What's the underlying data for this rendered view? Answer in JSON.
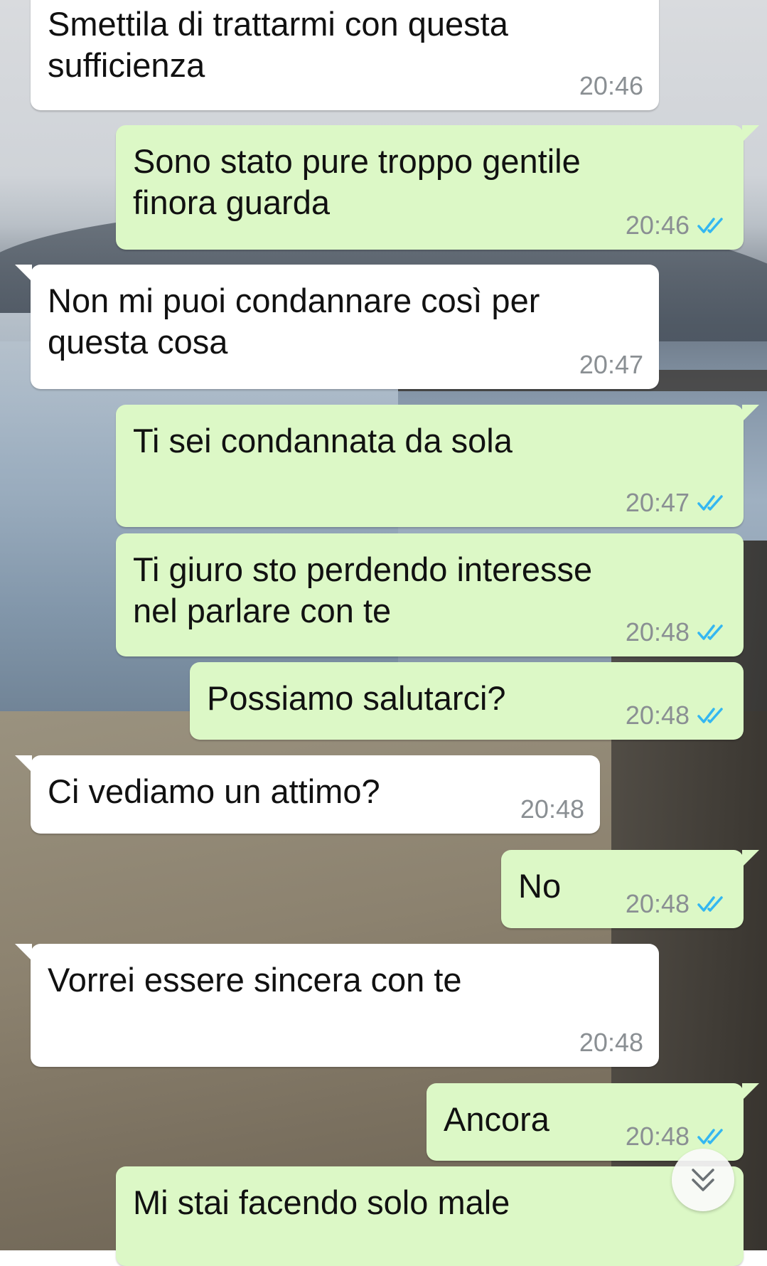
{
  "colors": {
    "incoming_bubble": "#ffffff",
    "outgoing_bubble": "#dcf8c6",
    "read_ticks": "#34b7f1",
    "timestamp": "#8a8f93"
  },
  "messages": [
    {
      "direction": "incoming",
      "text": "Smettila di trattarmi con questa\nsufficienza",
      "time": "20:46"
    },
    {
      "direction": "outgoing",
      "text": "Sono stato pure troppo gentile\nfinora guarda",
      "time": "20:46",
      "status": "read"
    },
    {
      "direction": "incoming",
      "text": "Non mi puoi condannare così per\nquesta cosa",
      "time": "20:47"
    },
    {
      "direction": "outgoing",
      "text": "Ti sei condannata da sola",
      "time": "20:47",
      "status": "read"
    },
    {
      "direction": "outgoing",
      "text": "Ti giuro sto perdendo interesse\nnel parlare con te",
      "time": "20:48",
      "status": "read"
    },
    {
      "direction": "outgoing",
      "text": "Possiamo salutarci?",
      "time": "20:48",
      "status": "read"
    },
    {
      "direction": "incoming",
      "text": "Ci vediamo un attimo?",
      "time": "20:48"
    },
    {
      "direction": "outgoing",
      "text": "No",
      "time": "20:48",
      "status": "read"
    },
    {
      "direction": "incoming",
      "text": "Vorrei essere sincera con te",
      "time": "20:48"
    },
    {
      "direction": "outgoing",
      "text": "Ancora",
      "time": "20:48",
      "status": "read"
    },
    {
      "direction": "outgoing",
      "text": "Mi stai facendo solo male"
    }
  ],
  "scroll_button": {
    "icon": "double-chevron-down-icon"
  }
}
